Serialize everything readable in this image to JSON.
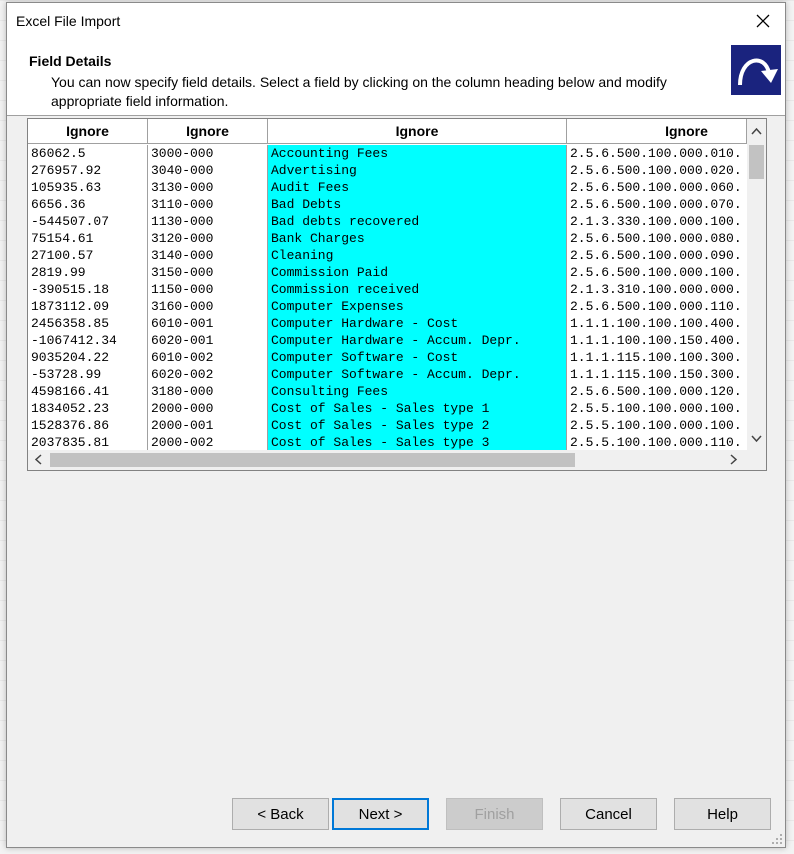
{
  "window": {
    "title": "Excel File Import"
  },
  "header": {
    "title": "Field Details",
    "description": "You can now specify field details. Select a field by clicking on the column heading below and modify appropriate field information."
  },
  "grid": {
    "columns": [
      {
        "heading": "Ignore"
      },
      {
        "heading": "Ignore"
      },
      {
        "heading": "Ignore"
      },
      {
        "heading": "Ignore"
      }
    ],
    "col1": [
      "86062.5",
      "276957.92",
      "105935.63",
      "6656.36",
      "-544507.07",
      "75154.61",
      "27100.57",
      "2819.99",
      "-390515.18",
      "1873112.09",
      "2456358.85",
      "-1067412.34",
      "9035204.22",
      "-53728.99",
      "4598166.41",
      "1834052.23",
      "1528376.86",
      "2037835.81"
    ],
    "col2": [
      "3000-000",
      "3040-000",
      "3130-000",
      "3110-000",
      "1130-000",
      "3120-000",
      "3140-000",
      "3150-000",
      "1150-000",
      "3160-000",
      "6010-001",
      "6020-001",
      "6010-002",
      "6020-002",
      "3180-000",
      "2000-000",
      "2000-001",
      "2000-002"
    ],
    "col3": [
      "Accounting Fees",
      "Advertising",
      "Audit Fees",
      "Bad Debts",
      "Bad debts recovered",
      "Bank Charges",
      "Cleaning",
      "Commission Paid",
      "Commission received",
      "Computer Expenses",
      "Computer Hardware - Cost",
      "Computer Hardware - Accum. Depr.",
      "Computer Software - Cost",
      "Computer Software - Accum. Depr.",
      "Consulting Fees",
      "Cost of Sales - Sales type 1",
      "Cost of Sales - Sales type 2",
      "Cost of Sales - Sales type 3"
    ],
    "col4": [
      "2.5.6.500.100.000.010.",
      "2.5.6.500.100.000.020.",
      "2.5.6.500.100.000.060.",
      "2.5.6.500.100.000.070.",
      "2.1.3.330.100.000.100.",
      "2.5.6.500.100.000.080.",
      "2.5.6.500.100.000.090.",
      "2.5.6.500.100.000.100.",
      "2.1.3.310.100.000.000.",
      "2.5.6.500.100.000.110.",
      "1.1.1.100.100.100.400.",
      "1.1.1.100.100.150.400.",
      "1.1.1.115.100.100.300.",
      "1.1.1.115.100.150.300.",
      "2.5.6.500.100.000.120.",
      "2.5.5.100.100.000.100.",
      "2.5.5.100.100.000.100.",
      "2.5.5.100.100.000.110."
    ]
  },
  "buttons": {
    "back": "< Back",
    "next": "Next >",
    "finish": "Finish",
    "cancel": "Cancel",
    "help": "Help"
  },
  "colors": {
    "selected_column": "#00ffff",
    "default_button_border": "#0078d7",
    "wizard_icon_bg": "#1a237e"
  },
  "icons": {
    "close": "close-icon",
    "wizard": "curved-arrow-icon"
  }
}
